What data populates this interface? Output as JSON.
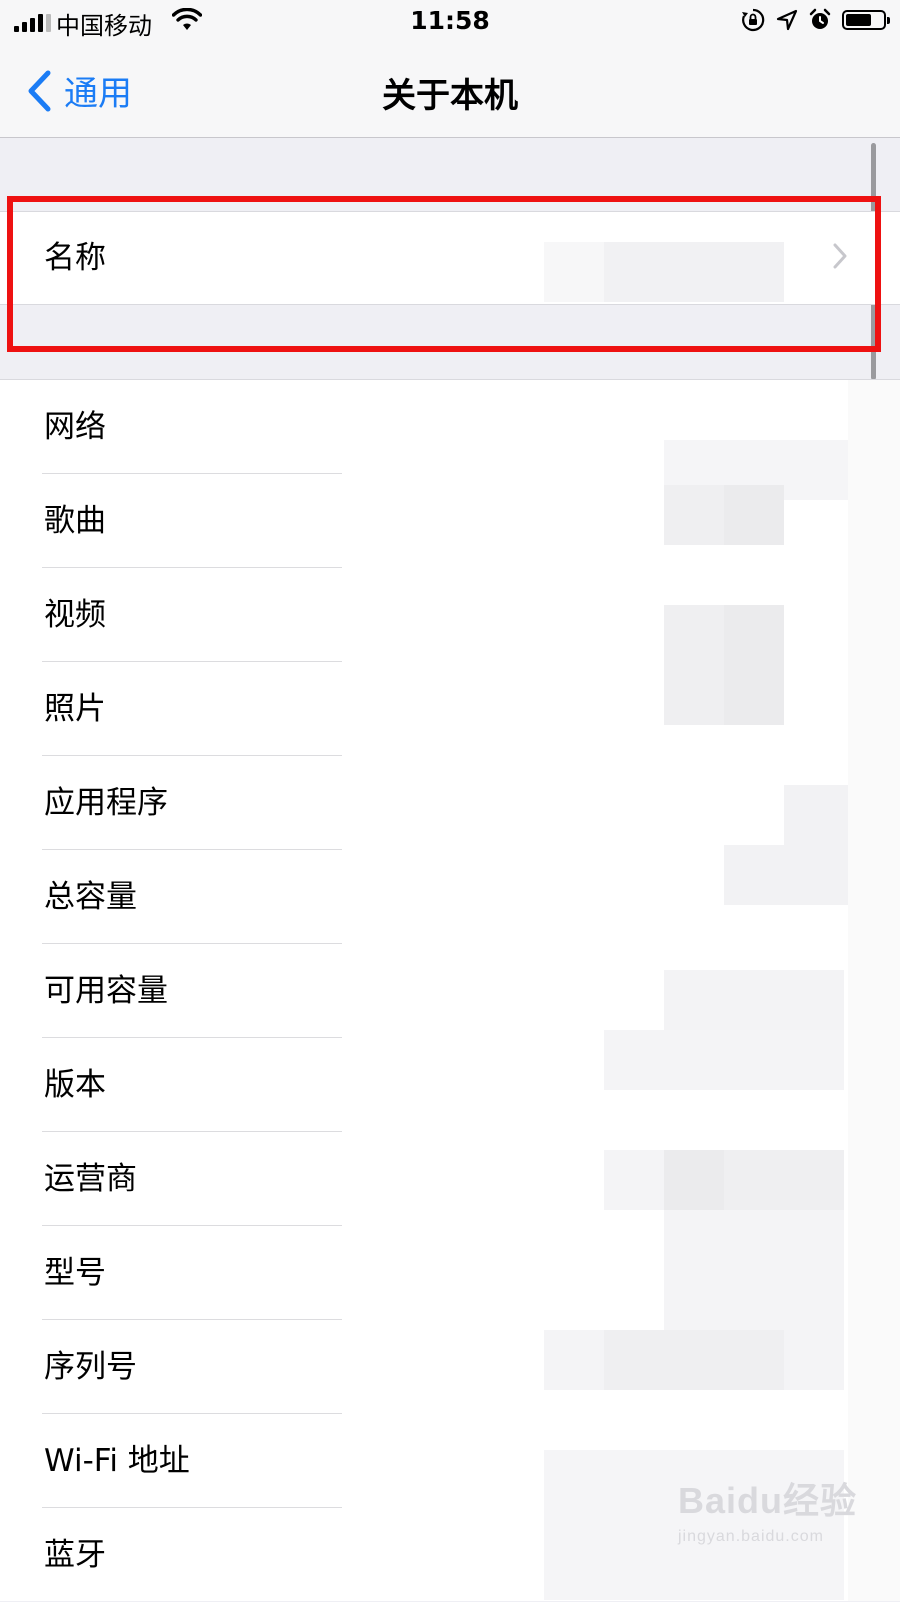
{
  "status_bar": {
    "carrier": "中国移动",
    "time": "11:58",
    "battery_level": 0.7
  },
  "nav": {
    "back_label": "通用",
    "title": "关于本机"
  },
  "name_row": {
    "label": "名称"
  },
  "items": [
    {
      "label": "网络"
    },
    {
      "label": "歌曲"
    },
    {
      "label": "视频"
    },
    {
      "label": "照片"
    },
    {
      "label": "应用程序"
    },
    {
      "label": "总容量"
    },
    {
      "label": "可用容量"
    },
    {
      "label": "版本"
    },
    {
      "label": "运营商"
    },
    {
      "label": "型号"
    },
    {
      "label": "序列号"
    },
    {
      "label": "Wi-Fi 地址"
    },
    {
      "label": "蓝牙"
    }
  ],
  "watermark": {
    "main": "Baidu经验",
    "sub": "jingyan.baidu.com"
  },
  "colors": {
    "accent": "#1b7cf5",
    "highlight": "#ee1111",
    "background": "#efeff4"
  },
  "icons": [
    "signal-icon",
    "wifi-icon",
    "orientation-lock-icon",
    "location-icon",
    "alarm-icon",
    "battery-icon",
    "back-chevron-icon",
    "disclosure-chevron-icon"
  ]
}
